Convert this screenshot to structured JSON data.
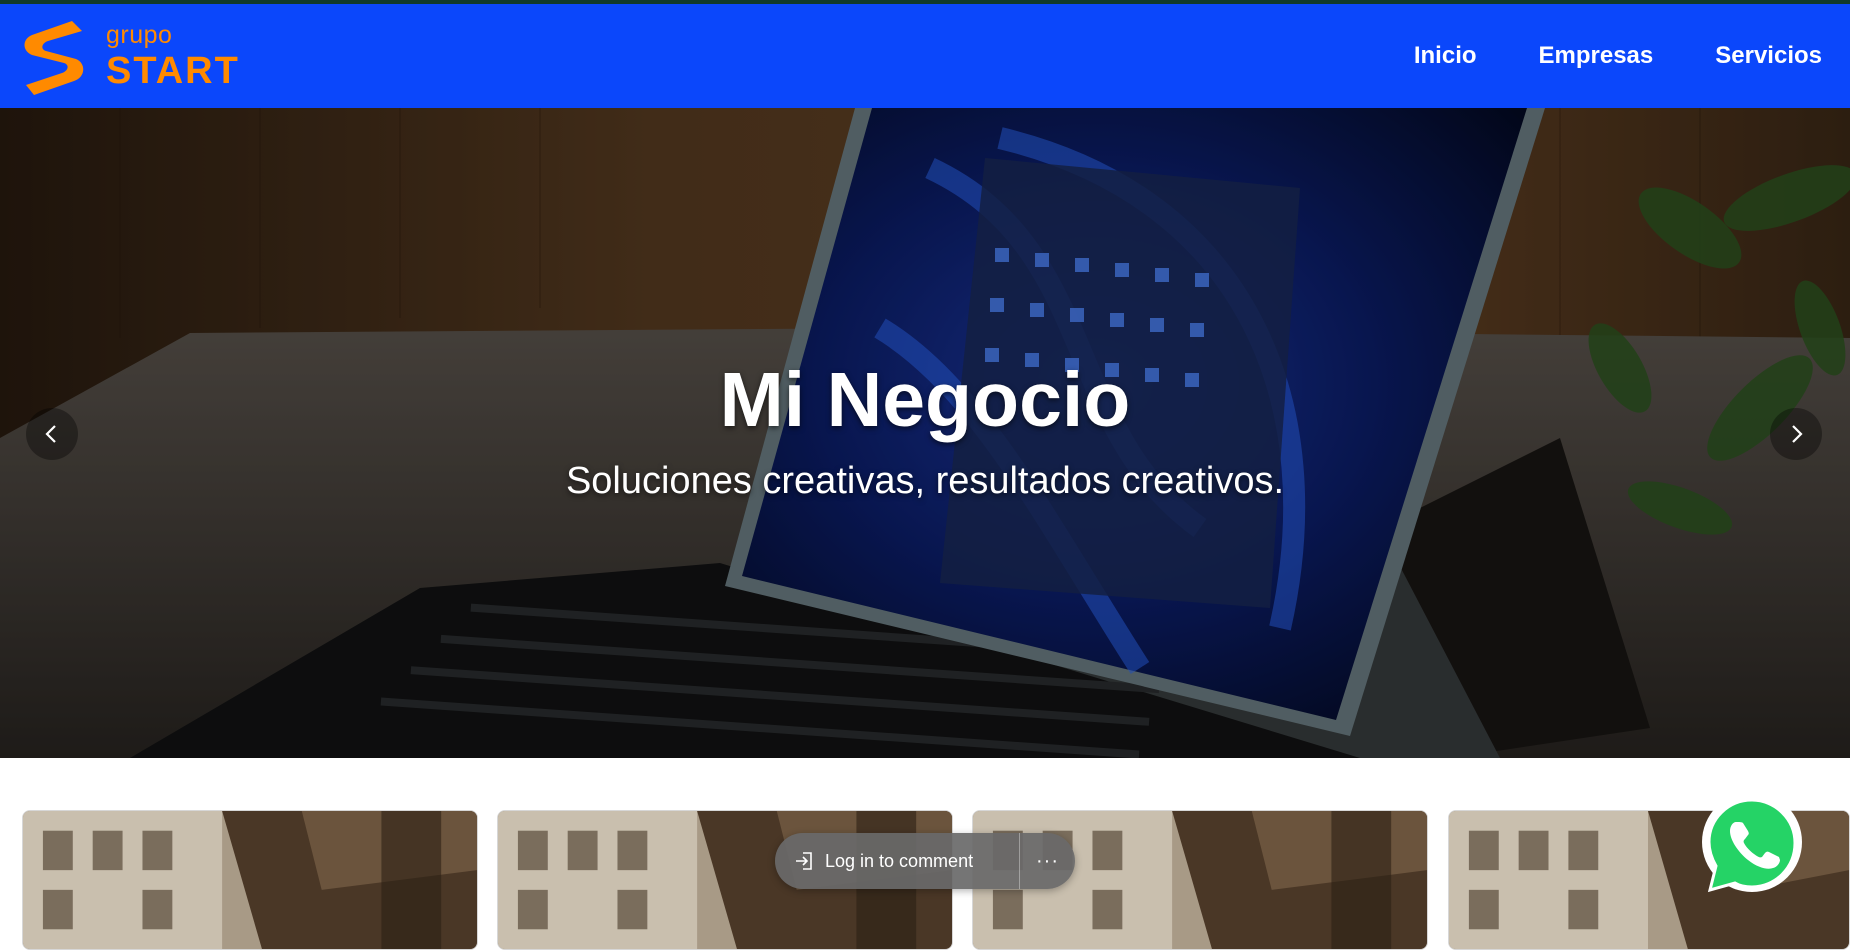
{
  "brand": {
    "small_text": "grupo",
    "big_text": "START",
    "logo_icon": "s-logo-icon",
    "accent_color": "#ff8a00"
  },
  "navbar": {
    "background_color": "#0b47fb",
    "links": [
      {
        "label": "Inicio"
      },
      {
        "label": "Empresas"
      },
      {
        "label": "Servicios"
      }
    ]
  },
  "hero": {
    "title": "Mi Negocio",
    "subtitle": "Soluciones creativas, resultados creativos.",
    "prev_icon": "chevron-left-icon",
    "next_icon": "chevron-right-icon"
  },
  "cards": {
    "count_visible": 4
  },
  "comment_bar": {
    "label": "Log in to comment",
    "icon": "login-icon",
    "more_label": "···"
  },
  "whatsapp": {
    "icon": "whatsapp-icon",
    "color": "#25d366"
  }
}
